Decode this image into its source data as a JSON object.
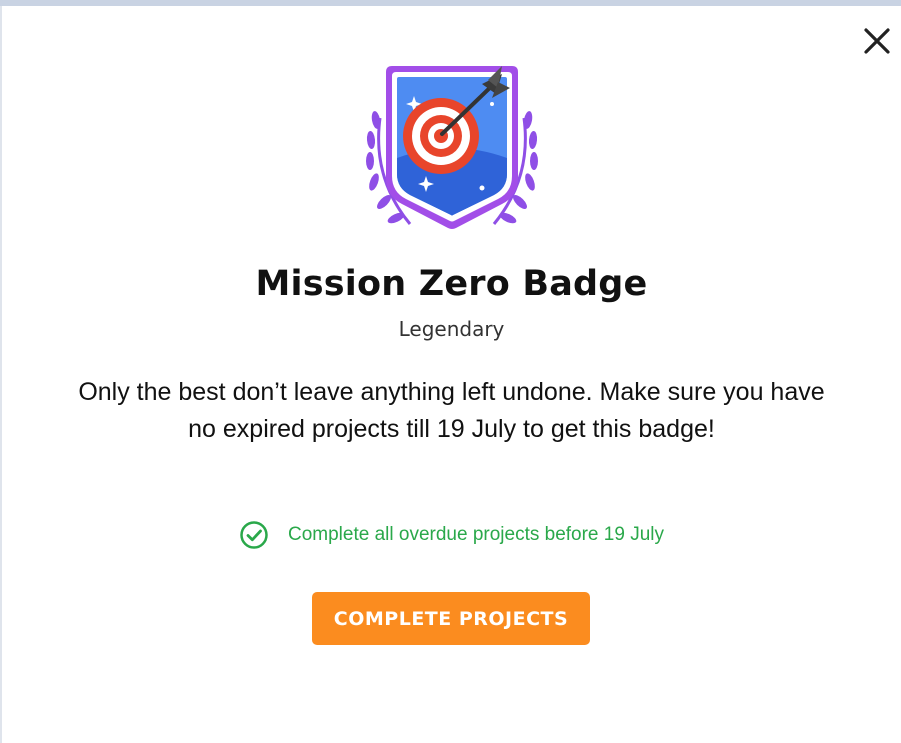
{
  "badge": {
    "title": "Mission Zero Badge",
    "rarity": "Legendary",
    "description": "Only the best don’t leave anything left undone. Make sure you have no expired projects till 19 July to get this badge!",
    "icon": "target-arrow-badge-icon"
  },
  "requirements": [
    {
      "text": "Complete all overdue projects before 19 July",
      "status": "complete",
      "icon": "check-circle-icon"
    }
  ],
  "actions": {
    "primary_label": "COMPLETE PROJECTS",
    "close_icon": "close-icon"
  },
  "colors": {
    "accent": "#fb8c1f",
    "success": "#2aa84a",
    "badge_frame": "#a24ee8",
    "badge_bg": "#3f7ff0",
    "target_red": "#e8452b"
  }
}
